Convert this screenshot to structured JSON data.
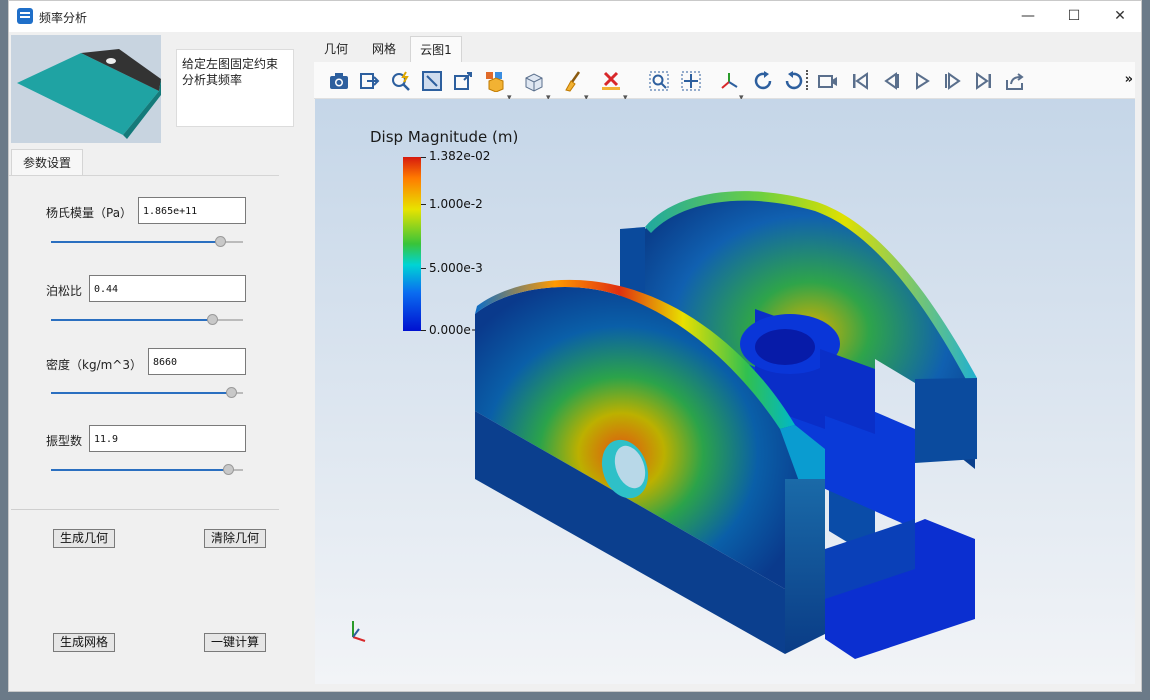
{
  "window": {
    "title": "频率分析",
    "controls": {
      "minimize": "—",
      "maximize": "☐",
      "close": "✕"
    }
  },
  "left_panel": {
    "description": "给定左图固定约束分析其频率",
    "param_tab": "参数设置",
    "params": [
      {
        "label": "杨氏模量（Pa）",
        "value": "1.865e+11",
        "slider_level": 0.88
      },
      {
        "label": "泊松比",
        "value": "0.44",
        "slider_level": 0.84
      },
      {
        "label": "密度（kg/m^3）",
        "value": "8660",
        "slider_level": 0.94
      },
      {
        "label": "振型数",
        "value": "11.9",
        "slider_level": 0.92
      }
    ],
    "buttons": {
      "generate_geometry": "生成几何",
      "clear_geometry": "清除几何",
      "generate_mesh": "生成网格",
      "one_click_compute": "一键计算"
    }
  },
  "tabs": [
    "几何",
    "网格",
    "云图1"
  ],
  "active_tab": "云图1",
  "toolbar_icons": [
    "screenshot-icon",
    "export-icon",
    "probe-icon",
    "fit-view-icon",
    "box-select-icon",
    "display-mode-icon",
    "transparency-icon",
    "clear-brush-icon",
    "delete-icon",
    "zoom-box-icon",
    "pan-icon",
    "axes-icon",
    "rotate-cw-icon",
    "rotate-ccw-icon",
    "record-icon",
    "first-frame-icon",
    "prev-frame-icon",
    "play-icon",
    "next-frame-icon",
    "last-frame-icon",
    "export-anim-icon"
  ],
  "toolbar_more": "»",
  "legend": {
    "title": "Disp Magnitude (m)",
    "labels": [
      "1.382e-02",
      "1.000e-2",
      "5.000e-3",
      "0.000e+00"
    ]
  }
}
